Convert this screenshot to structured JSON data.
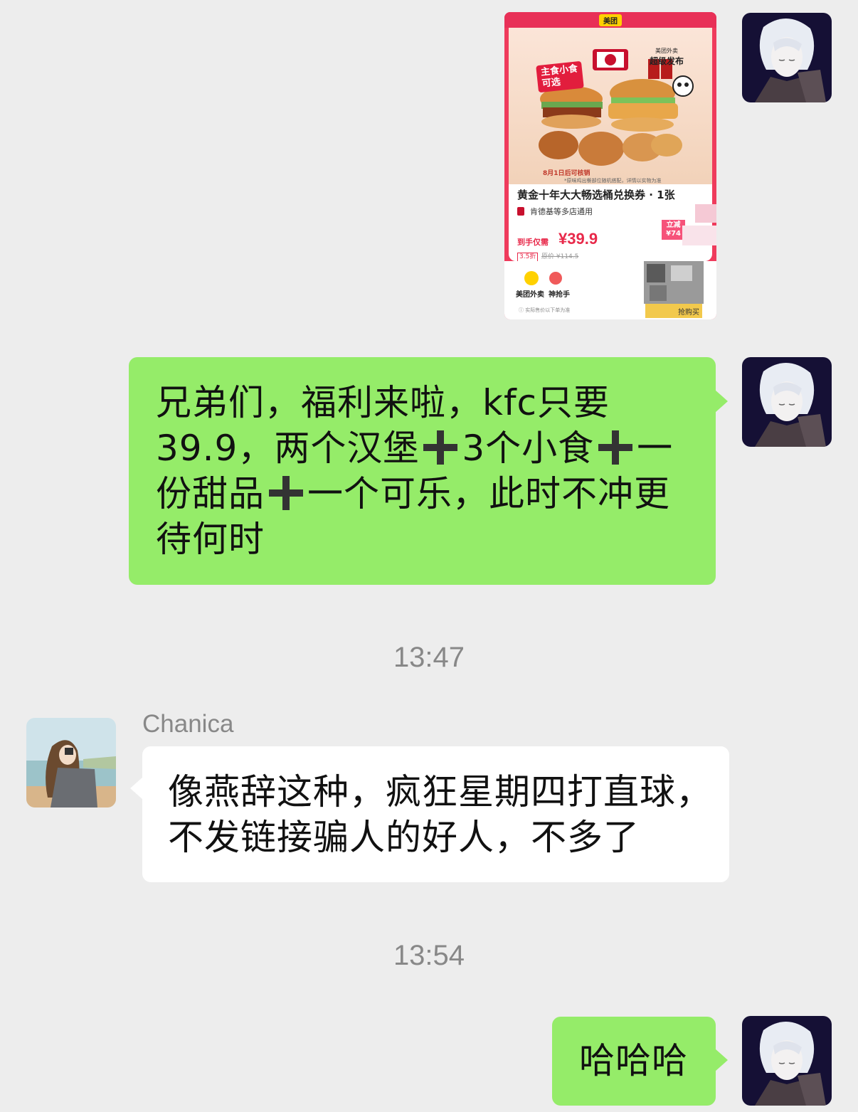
{
  "messages": [
    {
      "id": "coupon",
      "side": "right",
      "type": "image",
      "card": {
        "brand": "美团",
        "badge_main_line1": "主食小食",
        "badge_main_line2": "可选",
        "release_small": "美团外卖",
        "release_big": "超级发布",
        "note_date": "8月1日后可核销",
        "note_small": "*原味鸡出餐部位随机搭配，详情以实物为准",
        "title": "黄金十年大大畅选桶兑换券 · 1张",
        "store": "肯德基等多店通用",
        "price_label": "到手仅需",
        "price": "¥39.9",
        "discount": "3.5折",
        "original_price": "原价 ¥114.5",
        "cut_label": "立减",
        "cut_amount": "¥74",
        "brand_waimai": "美团外卖",
        "brand_shenqiang": "神抢手",
        "foot_note": "ⓘ 实际售价以下单为准",
        "buy_label": "抢购买"
      }
    },
    {
      "id": "msg1",
      "side": "right",
      "type": "text",
      "line1": "兄弟们，福利来啦，kfc只要",
      "line2_a": "39.9，两个汉堡",
      "line2_b": "3个小食",
      "line2_c": "一",
      "line3_a": "份甜品",
      "line3_b": "一个可乐，此时不冲更",
      "line4": "待何时"
    },
    {
      "id": "ts1",
      "type": "timestamp",
      "text": "13:47"
    },
    {
      "id": "msg2",
      "side": "left",
      "type": "text",
      "sender": "Chanica",
      "line1": "像燕辞这种，疯狂星期四打直球，",
      "line2": "不发链接骗人的好人，不多了"
    },
    {
      "id": "ts2",
      "type": "timestamp",
      "text": "13:54"
    },
    {
      "id": "msg3",
      "side": "right",
      "type": "text",
      "text": "哈哈哈"
    }
  ],
  "colors": {
    "background": "#ededed",
    "bubble_self": "#95ec69",
    "bubble_other": "#ffffff",
    "meta_text": "#888888"
  },
  "icons": {
    "plus": "heavy-plus-sign-emoji"
  }
}
